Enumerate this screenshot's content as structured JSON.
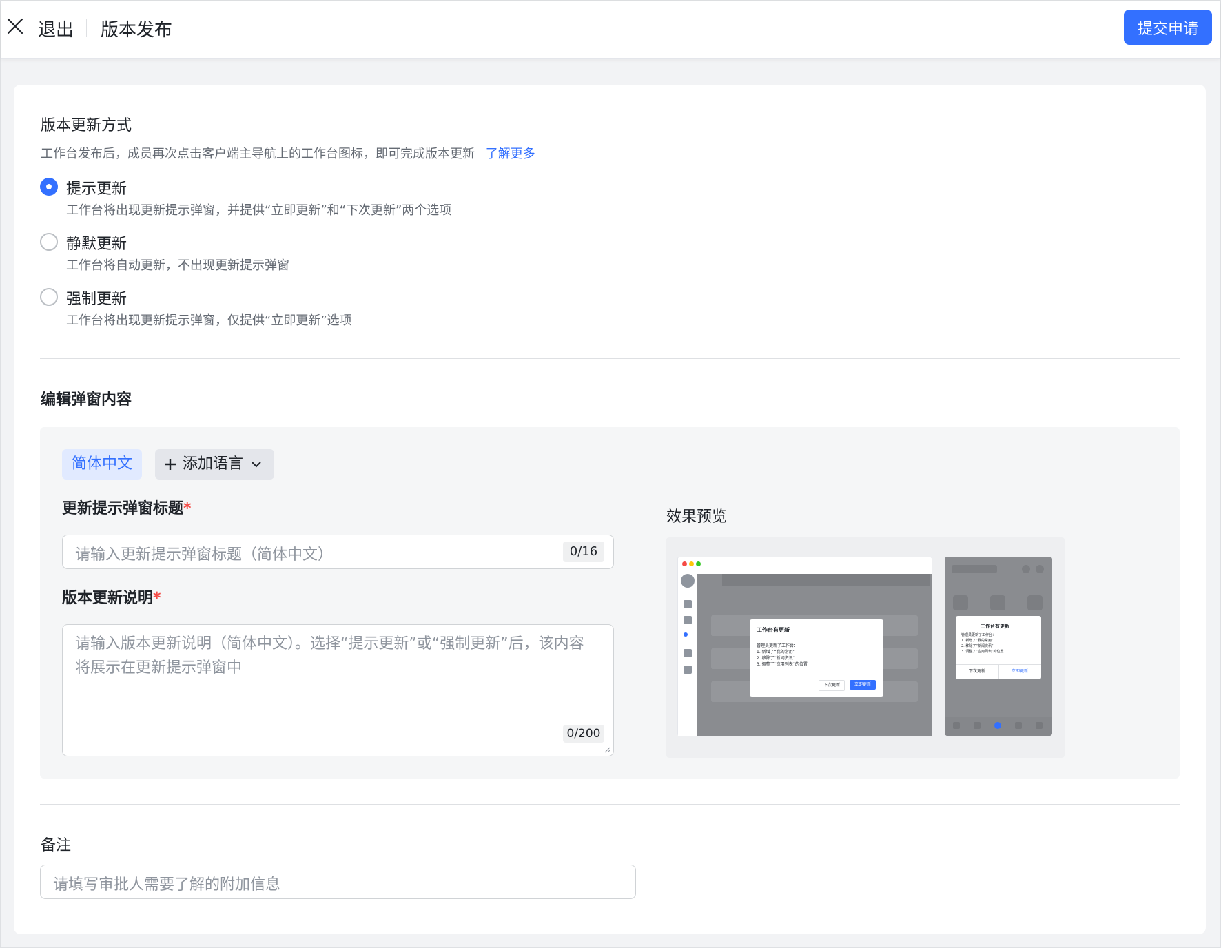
{
  "header": {
    "exit_label": "退出",
    "page_title": "版本发布",
    "submit_label": "提交申请",
    "accent_color": "#3370ff"
  },
  "update_method": {
    "title": "版本更新方式",
    "description": "工作台发布后，成员再次点击客户端主导航上的工作台图标，即可完成版本更新",
    "learn_more": "了解更多",
    "selected": "提示更新",
    "options": [
      {
        "label": "提示更新",
        "desc": "工作台将出现更新提示弹窗，并提供“立即更新”和“下次更新”两个选项",
        "checked": true
      },
      {
        "label": "静默更新",
        "desc": "工作台将自动更新，不出现更新提示弹窗",
        "checked": false
      },
      {
        "label": "强制更新",
        "desc": "工作台将出现更新提示弹窗，仅提供“立即更新”选项",
        "checked": false
      }
    ]
  },
  "popup_editor": {
    "title": "编辑弹窗内容",
    "active_language": "简体中文",
    "add_language": "添加语言",
    "title_field": {
      "label": "更新提示弹窗标题",
      "required_mark": "*",
      "placeholder": "请输入更新提示弹窗标题（简体中文）",
      "counter": "0/16"
    },
    "desc_field": {
      "label": "版本更新说明",
      "required_mark": "*",
      "placeholder": "请输入版本更新说明（简体中文）。选择“提示更新”或“强制更新”后，该内容将展示在更新提示弹窗中",
      "counter": "0/200"
    },
    "preview": {
      "label": "效果预览",
      "dialog_title": "工作台有更新",
      "dialog_lines": [
        "管理员更新了工作台：",
        "1. 新增了“我的常用”",
        "2. 移除了“新闻资讯”",
        "3. 调整了“应用列表”的位置"
      ],
      "later_button": "下次更新",
      "now_button": "立即更新"
    }
  },
  "remark": {
    "title": "备注",
    "placeholder": "请填写审批人需要了解的附加信息"
  }
}
